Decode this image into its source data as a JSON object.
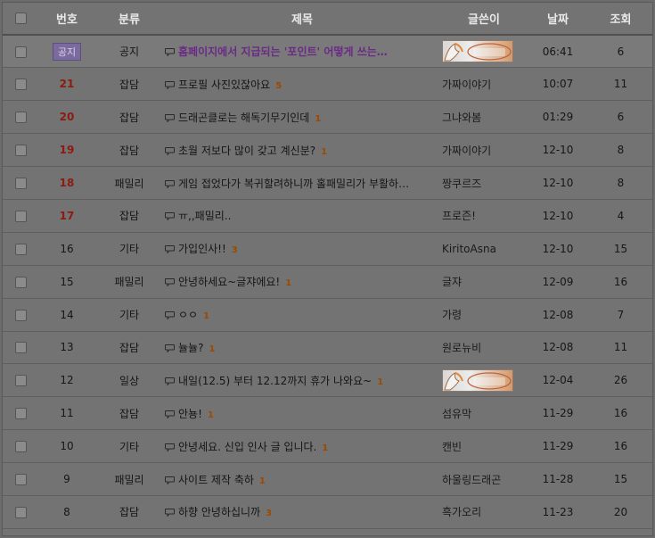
{
  "header": {
    "checkbox": "",
    "number": "번호",
    "category": "분류",
    "subject": "제목",
    "author": "글쓴이",
    "date": "날짜",
    "views": "조회"
  },
  "icons": {
    "comment": "speech-bubble-icon",
    "checkbox": "checkbox"
  },
  "colors": {
    "notice_badge": "#7b6a9e",
    "hot_number": "#8c1b10",
    "notice_subject": "#6a2a86",
    "comment_count": "#9a4a00"
  },
  "posts": [
    {
      "num": "공지",
      "notice": true,
      "cat": "공지",
      "subj": "홈페이지에서 지급되는 '포인트' 어떻게 쓰는…",
      "cmt": "",
      "author": "",
      "author_image": true,
      "date": "06:41",
      "views": "6"
    },
    {
      "num": "21",
      "hot": true,
      "cat": "잡담",
      "subj": "프로필 사진있잖아요",
      "cmt": "5",
      "author": "가짜이야기",
      "date": "10:07",
      "views": "11"
    },
    {
      "num": "20",
      "hot": true,
      "cat": "잡담",
      "subj": "드래곤클로는 해독기무기인데",
      "cmt": "1",
      "author": "그냐와봄",
      "date": "01:29",
      "views": "6"
    },
    {
      "num": "19",
      "hot": true,
      "cat": "잡담",
      "subj": "초월 저보다 많이 갖고 계신분?",
      "cmt": "1",
      "author": "가짜이야기",
      "date": "12-10",
      "views": "8"
    },
    {
      "num": "18",
      "hot": true,
      "cat": "패밀리",
      "subj": "게임 접었다가 복귀할려하니까 홀패밀리가 부활하…",
      "cmt": "",
      "author": "짱쿠르즈",
      "date": "12-10",
      "views": "8"
    },
    {
      "num": "17",
      "hot": true,
      "cat": "잡담",
      "subj": "ㅠ,,패밀리..",
      "cmt": "",
      "author": "프로즌!",
      "date": "12-10",
      "views": "4"
    },
    {
      "num": "16",
      "cat": "기타",
      "subj": "가입인사!!",
      "cmt": "3",
      "author": "KiritoAsna",
      "date": "12-10",
      "views": "15"
    },
    {
      "num": "15",
      "cat": "패밀리",
      "subj": "안녕하세요~글쟈에요!",
      "cmt": "1",
      "author": "글쟈",
      "date": "12-09",
      "views": "16"
    },
    {
      "num": "14",
      "cat": "기타",
      "subj": "ㅇㅇ",
      "cmt": "1",
      "author": "가령",
      "date": "12-08",
      "views": "7"
    },
    {
      "num": "13",
      "cat": "잡담",
      "subj": "뉼뉼?",
      "cmt": "1",
      "author": "원로뉴비",
      "date": "12-08",
      "views": "11"
    },
    {
      "num": "12",
      "cat": "일상",
      "subj": "내일(12.5) 부터 12.12까지 휴가 나와요~",
      "cmt": "1",
      "author": "",
      "author_image": true,
      "date": "12-04",
      "views": "26"
    },
    {
      "num": "11",
      "cat": "잡담",
      "subj": "안뇽!",
      "cmt": "1",
      "author": "섬유막",
      "date": "11-29",
      "views": "16"
    },
    {
      "num": "10",
      "cat": "기타",
      "subj": "안녕세요. 신입 인사 글 입니다.",
      "cmt": "1",
      "author": "캔빈",
      "date": "11-29",
      "views": "16"
    },
    {
      "num": "9",
      "cat": "패밀리",
      "subj": "사이트 제작 축하",
      "cmt": "1",
      "author": "하울링드래곤",
      "date": "11-28",
      "views": "15"
    },
    {
      "num": "8",
      "cat": "잡담",
      "subj": "하향 안녕하십니까",
      "cmt": "3",
      "author": "흑가오리",
      "date": "11-23",
      "views": "20"
    }
  ]
}
